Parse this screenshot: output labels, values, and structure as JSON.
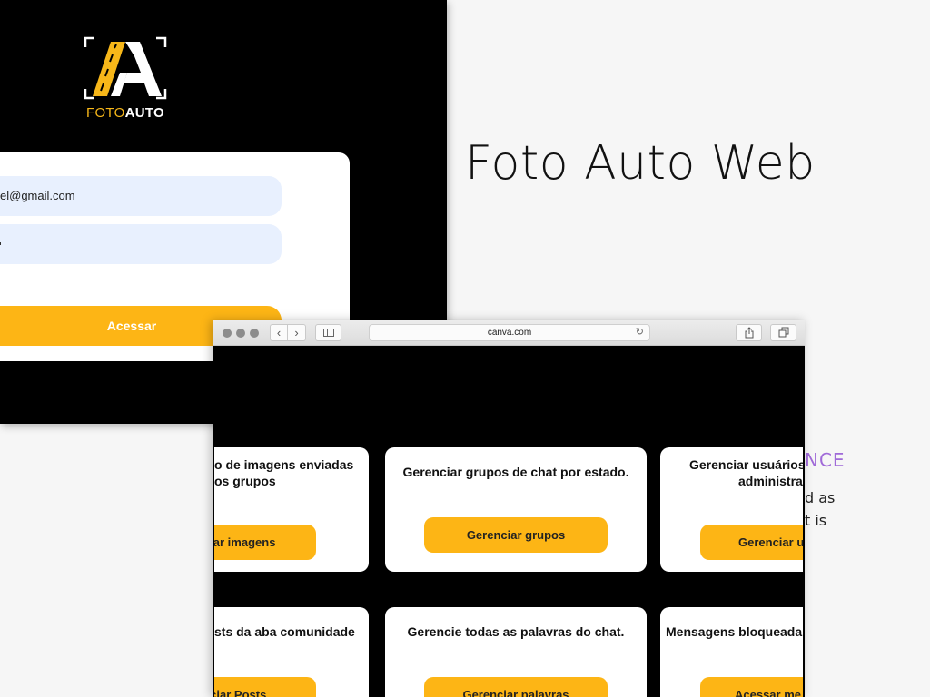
{
  "slide": {
    "title": "Foto Auto Web",
    "accent_text": "NCE",
    "body_lines": [
      "d as",
      "t is"
    ]
  },
  "login": {
    "logo_icon": "foto-auto-logo",
    "logo_text_foto": "FOTO",
    "logo_text_auto": "AUTO",
    "email_value": "el@gmail.com",
    "password_value": "",
    "submit_label": "Acessar"
  },
  "browser": {
    "url": "canva.com",
    "back_icon": "chevron-left-icon",
    "forward_icon": "chevron-right-icon",
    "reload_icon": "reload-icon",
    "share_icon": "share-icon",
    "tabs_icon": "tabs-icon"
  },
  "dashboard": {
    "cards": [
      {
        "text": "o de imagens enviadas",
        "text_line2": "os grupos",
        "button": "nciar imagens"
      },
      {
        "text": "Gerenciar grupos de chat por estado.",
        "button": "Gerenciar grupos"
      },
      {
        "text": "Gerenciar usuários",
        "text_line2": "administra",
        "button": "Gerenciar u"
      },
      {
        "text": "sts da aba comunidade",
        "button": "enciar Posts"
      },
      {
        "text": "Gerencie todas as palavras do chat.",
        "button": "Gerenciar palavras"
      },
      {
        "text": "Mensagens bloqueada",
        "button": "Acessar me"
      }
    ]
  },
  "colors": {
    "brand_yellow": "#fdb515",
    "accent_purple": "#a06ad8",
    "input_bg": "#e8f0fe"
  }
}
